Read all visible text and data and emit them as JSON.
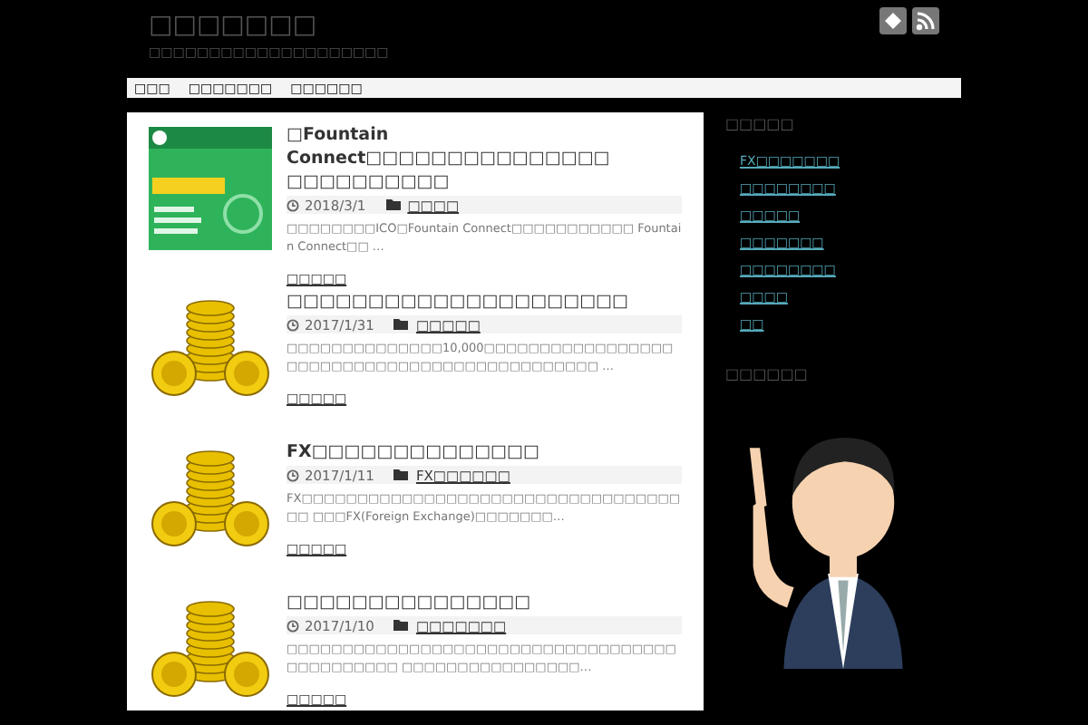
{
  "site": {
    "title": "□□□□□□□",
    "tagline": "□□□□□□□□□□□□□□□□□□□□"
  },
  "nav": [
    "□□□",
    "□□□□□□□",
    "□□□□□□"
  ],
  "posts": [
    {
      "kind": "banner",
      "title": "□Fountain Connect□□□□□□□□□□□□□□□ □□□□□□□□□□",
      "date": "2018/3/1",
      "category": "□□□□",
      "excerpt": "□□□□□□□□ICO□Fountain Connect□□□□□□□□□□□ Fountain Connect□□ …",
      "more": "□□□□□"
    },
    {
      "kind": "coins",
      "title": "□□□□□□□□□□□□□□□□□□□□□",
      "date": "2017/1/31",
      "category": "□□□□□",
      "excerpt": "□□□□□□□□□□□□□□10,000□□□□□□□□□□□□□□□□□□□□□□□□□□□□□□□□□□□□□□□□□□□□□ …",
      "more": "□□□□□"
    },
    {
      "kind": "coins",
      "title": "FX□□□□□□□□□□□□□□",
      "date": "2017/1/11",
      "category": "FX□□□□□□",
      "excerpt": "FX□□□□□□□□□□□□□□□□□□□□□□□□□□□□□□□□□□□□ □□□FX(Foreign Exchange)□□□□□□□…",
      "more": "□□□□□"
    },
    {
      "kind": "coins",
      "title": "□□□□□□□□□□□□□□□",
      "date": "2017/1/10",
      "category": "□□□□□□□",
      "excerpt": "□□□□□□□□□□□□□□□□□□□□□□□□□□□□□□□□□□□□□□□□□□□□□ □□□□□□□□□□□□□□□□…",
      "more": "□□□□□"
    }
  ],
  "sidebar": {
    "heading": "□□□□□",
    "links": [
      "FX□□□□□□□",
      "□□□□□□□□",
      "□□□□□",
      "□□□□□□□",
      "□□□□□□□□",
      "□□□□",
      "□□"
    ],
    "heading_2": "□□□□□□"
  }
}
